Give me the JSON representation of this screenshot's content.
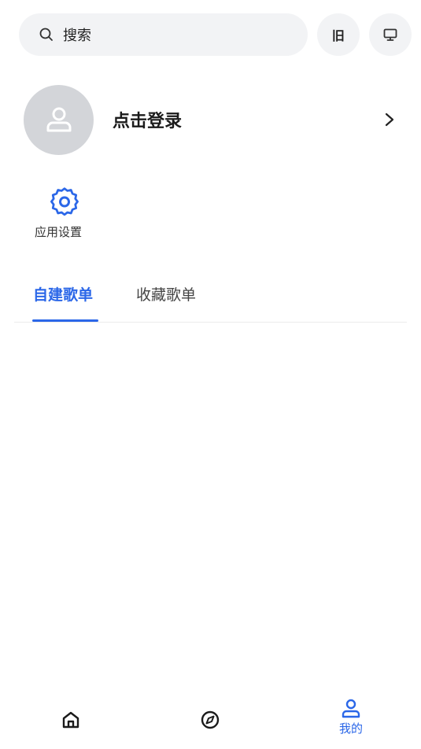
{
  "search": {
    "label": "搜索",
    "icon": "search-icon"
  },
  "top_buttons": {
    "old_label": "旧",
    "desktop_icon": "monitor-icon"
  },
  "profile": {
    "login_label": "点击登录",
    "avatar_icon": "user-icon",
    "chevron_icon": "chevron-right-icon"
  },
  "settings": {
    "label": "应用设置",
    "icon": "gear-icon"
  },
  "tabs": [
    {
      "label": "自建歌单",
      "active": true
    },
    {
      "label": "收藏歌单",
      "active": false
    }
  ],
  "bottom_nav": [
    {
      "icon": "home-icon",
      "label": ""
    },
    {
      "icon": "compass-icon",
      "label": ""
    },
    {
      "icon": "user-icon",
      "label": "我的",
      "active": true
    }
  ],
  "colors": {
    "accent": "#2b67e8",
    "search_bg": "#f2f3f5",
    "avatar_bg": "#d3d5d9"
  }
}
